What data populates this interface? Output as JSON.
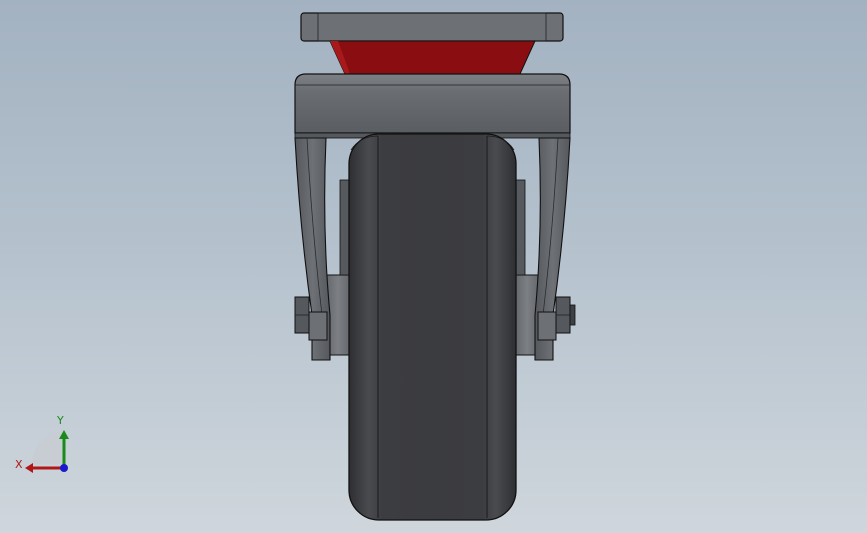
{
  "viewport": {
    "background_top": "#a3b2c1",
    "background_bottom": "#cfd6dc"
  },
  "model": {
    "parts": {
      "top_plate": "top-plate",
      "swivel_bearing": "swivel-bearing",
      "fork_yoke": "fork-yoke",
      "fork_leg_left": "fork-leg-left",
      "fork_leg_right": "fork-leg-right",
      "axle_nut_left": "axle-nut-left",
      "axle_nut_right": "axle-nut-right",
      "wheel": "wheel"
    },
    "colors": {
      "steel": "#6b6e72",
      "steel_dark": "#4a4c50",
      "bearing_red": "#8e0f12",
      "tire": "#3a3b3e",
      "outline": "#111111"
    }
  },
  "triad": {
    "x_label": "X",
    "y_label": "Y",
    "x_color": "#b01818",
    "y_color": "#1a8a1a",
    "z_color": "#1a1acc"
  }
}
